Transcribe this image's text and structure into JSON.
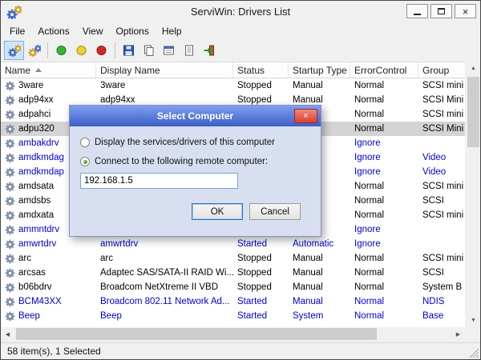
{
  "window": {
    "title": "ServiWin: Drivers List"
  },
  "menu": {
    "items": [
      "File",
      "Actions",
      "View",
      "Options",
      "Help"
    ]
  },
  "toolbar": {
    "buttons": [
      "local-drivers",
      "remote-drivers",
      "start-driver",
      "pause-driver",
      "stop-driver",
      "save-report",
      "copy-selected",
      "properties",
      "open-report",
      "exit"
    ]
  },
  "table": {
    "columns": [
      "Name",
      "Display Name",
      "Status",
      "Startup Type",
      "ErrorControl",
      "Group"
    ],
    "rows": [
      {
        "name": "3ware",
        "display": "3ware",
        "status": "Stopped",
        "startup": "Manual",
        "error": "Normal",
        "group": "SCSI mini",
        "blue": false,
        "selected": false
      },
      {
        "name": "adp94xx",
        "display": "adp94xx",
        "status": "Stopped",
        "startup": "Manual",
        "error": "Normal",
        "group": "SCSI Mini",
        "blue": false,
        "selected": false
      },
      {
        "name": "adpahci",
        "display": "",
        "status": "",
        "startup": "",
        "error": "Normal",
        "group": "SCSI mini",
        "blue": false,
        "selected": false
      },
      {
        "name": "adpu320",
        "display": "",
        "status": "",
        "startup": "",
        "error": "Normal",
        "group": "SCSI Mini",
        "blue": false,
        "selected": true
      },
      {
        "name": "ambakdrv",
        "display": "",
        "status": "",
        "startup": "",
        "error": "Ignore",
        "group": "",
        "blue": true,
        "selected": false
      },
      {
        "name": "amdkmdag",
        "display": "",
        "status": "",
        "startup": "",
        "error": "Ignore",
        "group": "Video",
        "blue": true,
        "selected": false
      },
      {
        "name": "amdkmdap",
        "display": "",
        "status": "",
        "startup": "",
        "error": "Ignore",
        "group": "Video",
        "blue": true,
        "selected": false
      },
      {
        "name": "amdsata",
        "display": "",
        "status": "",
        "startup": "",
        "error": "Normal",
        "group": "SCSI mini",
        "blue": false,
        "selected": false
      },
      {
        "name": "amdsbs",
        "display": "",
        "status": "",
        "startup": "",
        "error": "Normal",
        "group": "SCSI",
        "blue": false,
        "selected": false
      },
      {
        "name": "amdxata",
        "display": "",
        "status": "",
        "startup": "",
        "error": "Normal",
        "group": "SCSI mini",
        "blue": false,
        "selected": false
      },
      {
        "name": "ammntdrv",
        "display": "",
        "status": "",
        "startup": "",
        "error": "Ignore",
        "group": "",
        "blue": true,
        "selected": false
      },
      {
        "name": "amwrtdrv",
        "display": "amwrtdrv",
        "status": "Started",
        "startup": "Automatic",
        "error": "Ignore",
        "group": "",
        "blue": true,
        "selected": false
      },
      {
        "name": "arc",
        "display": "arc",
        "status": "Stopped",
        "startup": "Manual",
        "error": "Normal",
        "group": "SCSI mini",
        "blue": false,
        "selected": false
      },
      {
        "name": "arcsas",
        "display": "Adaptec SAS/SATA-II RAID Wi...",
        "status": "Stopped",
        "startup": "Manual",
        "error": "Normal",
        "group": "SCSI",
        "blue": false,
        "selected": false
      },
      {
        "name": "b06bdrv",
        "display": "Broadcom NetXtreme II VBD",
        "status": "Stopped",
        "startup": "Manual",
        "error": "Normal",
        "group": "System B",
        "blue": false,
        "selected": false
      },
      {
        "name": "BCM43XX",
        "display": "Broadcom 802.11 Network Ad...",
        "status": "Started",
        "startup": "Manual",
        "error": "Normal",
        "group": "NDIS",
        "blue": true,
        "selected": false
      },
      {
        "name": "Beep",
        "display": "Beep",
        "status": "Started",
        "startup": "System",
        "error": "Normal",
        "group": "Base",
        "blue": true,
        "selected": false
      }
    ]
  },
  "statusbar": {
    "text": "58 item(s), 1 Selected"
  },
  "dialog": {
    "title": "Select Computer",
    "close_glyph": "×",
    "options": [
      {
        "label": "Display the services/drivers of this computer",
        "selected": false
      },
      {
        "label": "Connect to the following remote computer:",
        "selected": true
      }
    ],
    "input": {
      "value": "192.168.1.5"
    },
    "buttons": {
      "ok": "OK",
      "cancel": "Cancel"
    }
  },
  "colors": {
    "running_row_text": "#0000d0",
    "selected_row_bg": "#d4d4d4",
    "dialog_title_top": "#7e9ff0",
    "dialog_title_bottom": "#3c5ec6",
    "close_button_red": "#d9402e"
  }
}
